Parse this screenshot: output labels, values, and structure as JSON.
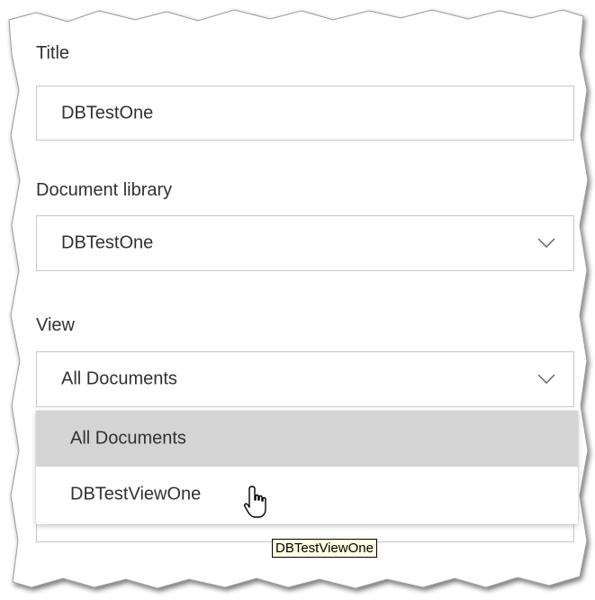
{
  "form": {
    "title_label": "Title",
    "title_value": "DBTestOne",
    "library_label": "Document library",
    "library_value": "DBTestOne",
    "view_label": "View",
    "view_value": "All Documents"
  },
  "view_dropdown": {
    "options": [
      {
        "label": "All Documents",
        "selected": true
      },
      {
        "label": "DBTestViewOne",
        "selected": false
      }
    ]
  },
  "tooltip": {
    "text": "DBTestViewOne"
  },
  "icons": {
    "chevron": "chevron-down-icon",
    "cursor": "hand-pointer-icon"
  },
  "colors": {
    "border": "#c8c6c4",
    "text": "#323130",
    "selected_option": "#d5d4d4",
    "tooltip_bg": "#ffffe1"
  }
}
